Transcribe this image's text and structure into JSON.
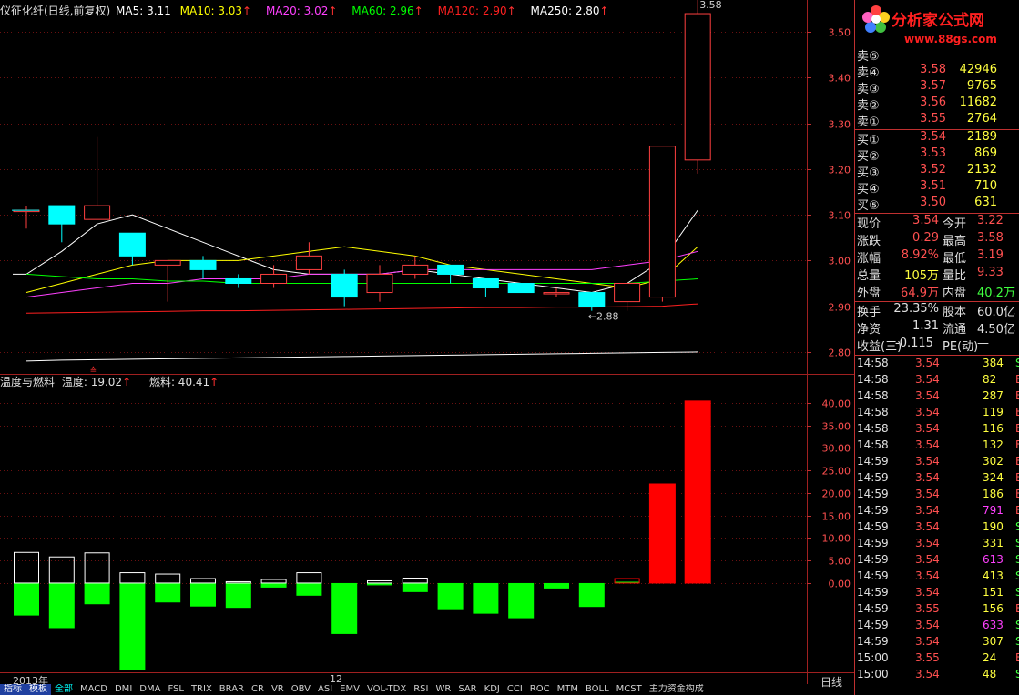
{
  "colors": {
    "up": "#ff4040",
    "down": "#00ffff",
    "ma5": "#ffffff",
    "ma10": "#ffff00",
    "ma20": "#ff40ff",
    "ma60": "#00ff00",
    "ma120": "#ff2020",
    "ma250": "#ffffff",
    "fuel": "#ff0000",
    "temp": "#00ff00"
  },
  "header": {
    "stock_title": "仪征化纤(日线,前复权)",
    "ma5": "MA5: 3.11",
    "ma10": "MA10: 3.03",
    "ma20": "MA20: 3.02",
    "ma60": "MA60: 2.96",
    "ma120": "MA120: 2.90",
    "ma250": "MA250: 2.80",
    "up_arrow": "↑"
  },
  "indicator": {
    "title": "温度与燃料",
    "temp_label": "温度: 19.02",
    "fuel_label": "燃料: 40.41",
    "up_arrow": "↑"
  },
  "price_axis": {
    "labels": [
      "3.50",
      "3.40",
      "3.30",
      "3.20",
      "3.10",
      "3.00",
      "2.90",
      "2.80"
    ]
  },
  "indicator_axis": {
    "labels": [
      "40.00",
      "35.00",
      "30.00",
      "25.00",
      "20.00",
      "15.00",
      "10.00",
      "5.00",
      "0.00"
    ]
  },
  "annotations": {
    "high": "3.58",
    "low": "2.88",
    "high_marker": "↙",
    "low_marker": "←",
    "year": "2013年",
    "month": "12",
    "event_marker": "≙"
  },
  "chart_data": {
    "type": "candlestick",
    "price_ylim": [
      2.75,
      3.55
    ],
    "candles": [
      {
        "o": 3.11,
        "c": 3.11,
        "h": 3.12,
        "l": 3.07
      },
      {
        "o": 3.12,
        "c": 3.08,
        "h": 3.12,
        "l": 3.04
      },
      {
        "o": 3.09,
        "c": 3.12,
        "h": 3.27,
        "l": 3.09
      },
      {
        "o": 3.06,
        "c": 3.01,
        "h": 3.06,
        "l": 2.99
      },
      {
        "o": 2.99,
        "c": 3.0,
        "h": 3.0,
        "l": 2.91
      },
      {
        "o": 3.0,
        "c": 2.98,
        "h": 3.01,
        "l": 2.96
      },
      {
        "o": 2.96,
        "c": 2.95,
        "h": 2.97,
        "l": 2.94
      },
      {
        "o": 2.95,
        "c": 2.97,
        "h": 2.99,
        "l": 2.94
      },
      {
        "o": 2.98,
        "c": 3.01,
        "h": 3.04,
        "l": 2.97
      },
      {
        "o": 2.97,
        "c": 2.92,
        "h": 2.98,
        "l": 2.9
      },
      {
        "o": 2.93,
        "c": 2.97,
        "h": 2.99,
        "l": 2.91
      },
      {
        "o": 2.97,
        "c": 2.99,
        "h": 3.01,
        "l": 2.96
      },
      {
        "o": 2.99,
        "c": 2.97,
        "h": 2.99,
        "l": 2.95
      },
      {
        "o": 2.96,
        "c": 2.94,
        "h": 2.96,
        "l": 2.92
      },
      {
        "o": 2.95,
        "c": 2.93,
        "h": 2.95,
        "l": 2.93
      },
      {
        "o": 2.93,
        "c": 2.93,
        "h": 2.94,
        "l": 2.92
      },
      {
        "o": 2.93,
        "c": 2.9,
        "h": 2.93,
        "l": 2.89
      },
      {
        "o": 2.91,
        "c": 2.95,
        "h": 2.95,
        "l": 2.89
      },
      {
        "o": 2.92,
        "c": 3.25,
        "h": 3.25,
        "l": 2.91
      },
      {
        "o": 3.22,
        "c": 3.54,
        "h": 3.58,
        "l": 3.19
      }
    ],
    "ma": [
      {
        "name": "MA5",
        "color": "#ffffff",
        "values": [
          2.97,
          3.02,
          3.08,
          3.1,
          3.07,
          3.04,
          3.01,
          2.98,
          2.97,
          2.97,
          2.97,
          2.98,
          2.97,
          2.96,
          2.95,
          2.94,
          2.93,
          2.95,
          3.0,
          3.11
        ]
      },
      {
        "name": "MA10",
        "color": "#ffff00",
        "values": [
          2.93,
          2.95,
          2.97,
          2.99,
          3.0,
          3.0,
          3.0,
          3.01,
          3.02,
          3.03,
          3.02,
          3.01,
          2.99,
          2.98,
          2.97,
          2.96,
          2.95,
          2.94,
          2.96,
          3.03
        ]
      },
      {
        "name": "MA20",
        "color": "#ff40ff",
        "values": [
          2.92,
          2.93,
          2.94,
          2.95,
          2.95,
          2.96,
          2.96,
          2.96,
          2.97,
          2.97,
          2.97,
          2.98,
          2.98,
          2.98,
          2.98,
          2.98,
          2.98,
          2.99,
          3.0,
          3.02
        ]
      },
      {
        "name": "MA60",
        "color": "#00ff00",
        "values": [
          2.97,
          2.965,
          2.96,
          2.96,
          2.955,
          2.955,
          2.95,
          2.95,
          2.95,
          2.95,
          2.95,
          2.95,
          2.95,
          2.95,
          2.95,
          2.95,
          2.95,
          2.95,
          2.955,
          2.96
        ]
      },
      {
        "name": "MA120",
        "color": "#ff2020",
        "values": [
          2.885,
          2.886,
          2.887,
          2.888,
          2.889,
          2.89,
          2.89,
          2.891,
          2.892,
          2.893,
          2.894,
          2.895,
          2.896,
          2.897,
          2.897,
          2.898,
          2.898,
          2.899,
          2.9,
          2.905
        ]
      },
      {
        "name": "MA250",
        "color": "#ffffff",
        "values": [
          2.78,
          2.782,
          2.783,
          2.784,
          2.785,
          2.786,
          2.787,
          2.788,
          2.789,
          2.79,
          2.791,
          2.792,
          2.793,
          2.794,
          2.795,
          2.796,
          2.797,
          2.798,
          2.799,
          2.8
        ]
      }
    ],
    "indicator_ylim": [
      -20,
      43
    ],
    "temp": [
      -7.2,
      -10,
      -4.7,
      -19.2,
      -4.3,
      -5.2,
      -5.5,
      -1,
      -2.8,
      -11.3,
      -0.5,
      -2,
      -6,
      -6.8,
      -7.8,
      -1.2,
      -5.3,
      0.3,
      0,
      0
    ],
    "fuel": [
      6.8,
      5.8,
      6.7,
      2.3,
      2,
      1,
      0.3,
      0.8,
      2.3,
      0,
      0.5,
      1.1,
      0,
      0,
      0,
      0,
      0,
      1,
      22,
      40.4
    ]
  },
  "order_book": {
    "asks": [
      {
        "label": "卖⑤",
        "price": "",
        "vol": ""
      },
      {
        "label": "卖④",
        "price": "3.58",
        "vol": "42946"
      },
      {
        "label": "卖③",
        "price": "3.57",
        "vol": "9765"
      },
      {
        "label": "卖②",
        "price": "3.56",
        "vol": "11682"
      },
      {
        "label": "卖①",
        "price": "3.55",
        "vol": "2764"
      }
    ],
    "bids": [
      {
        "label": "买①",
        "price": "3.54",
        "vol": "2189"
      },
      {
        "label": "买②",
        "price": "3.53",
        "vol": "869"
      },
      {
        "label": "买③",
        "price": "3.52",
        "vol": "2132"
      },
      {
        "label": "买④",
        "price": "3.51",
        "vol": "710"
      },
      {
        "label": "买⑤",
        "price": "3.50",
        "vol": "631"
      }
    ]
  },
  "quote": {
    "rows": [
      {
        "k1": "现价",
        "v1": "3.54",
        "k2": "今开",
        "v2": "3.22",
        "c1": "#ff5050",
        "c2": "#ff5050"
      },
      {
        "k1": "涨跌",
        "v1": "0.29",
        "k2": "最高",
        "v2": "3.58",
        "c1": "#ff5050",
        "c2": "#ff5050"
      },
      {
        "k1": "涨幅",
        "v1": "8.92%",
        "k2": "最低",
        "v2": "3.19",
        "c1": "#ff5050",
        "c2": "#ff5050"
      },
      {
        "k1": "总量",
        "v1": "105万",
        "k2": "量比",
        "v2": "9.33",
        "c1": "#ffff40",
        "c2": "#ff5050"
      },
      {
        "k1": "外盘",
        "v1": "64.9万",
        "k2": "内盘",
        "v2": "40.2万",
        "c1": "#ff5050",
        "c2": "#40ff40"
      },
      {
        "k1": "换手",
        "v1": "23.35%",
        "k2": "股本",
        "v2": "60.0亿",
        "c1": "#e0e0e0",
        "c2": "#e0e0e0"
      },
      {
        "k1": "净资",
        "v1": "1.31",
        "k2": "流通",
        "v2": "4.50亿",
        "c1": "#e0e0e0",
        "c2": "#e0e0e0"
      },
      {
        "k1": "收益(三)",
        "v1": "-0.115",
        "k2": "PE(动)",
        "v2": "—",
        "c1": "#e0e0e0",
        "c2": "#e0e0e0"
      }
    ]
  },
  "trades": [
    {
      "t": "14:58",
      "p": "3.54",
      "v": "384",
      "s": "S",
      "vc": "#ffff40",
      "sc": "#40ff40"
    },
    {
      "t": "14:58",
      "p": "3.54",
      "v": "82",
      "s": "B",
      "vc": "#ffff40",
      "sc": "#ff5050"
    },
    {
      "t": "14:58",
      "p": "3.54",
      "v": "287",
      "s": "B",
      "vc": "#ffff40",
      "sc": "#ff5050"
    },
    {
      "t": "14:58",
      "p": "3.54",
      "v": "119",
      "s": "B",
      "vc": "#ffff40",
      "sc": "#ff5050"
    },
    {
      "t": "14:58",
      "p": "3.54",
      "v": "116",
      "s": "B",
      "vc": "#ffff40",
      "sc": "#ff5050"
    },
    {
      "t": "14:58",
      "p": "3.54",
      "v": "132",
      "s": "B",
      "vc": "#ffff40",
      "sc": "#ff5050"
    },
    {
      "t": "14:59",
      "p": "3.54",
      "v": "302",
      "s": "B",
      "vc": "#ffff40",
      "sc": "#ff5050"
    },
    {
      "t": "14:59",
      "p": "3.54",
      "v": "324",
      "s": "B",
      "vc": "#ffff40",
      "sc": "#ff5050"
    },
    {
      "t": "14:59",
      "p": "3.54",
      "v": "186",
      "s": "B",
      "vc": "#ffff40",
      "sc": "#ff5050"
    },
    {
      "t": "14:59",
      "p": "3.54",
      "v": "791",
      "s": "B",
      "vc": "#ff40ff",
      "sc": "#ff5050"
    },
    {
      "t": "14:59",
      "p": "3.54",
      "v": "190",
      "s": "S",
      "vc": "#ffff40",
      "sc": "#40ff40"
    },
    {
      "t": "14:59",
      "p": "3.54",
      "v": "331",
      "s": "S",
      "vc": "#ffff40",
      "sc": "#40ff40"
    },
    {
      "t": "14:59",
      "p": "3.54",
      "v": "613",
      "s": "S",
      "vc": "#ff40ff",
      "sc": "#40ff40"
    },
    {
      "t": "14:59",
      "p": "3.54",
      "v": "413",
      "s": "S",
      "vc": "#ffff40",
      "sc": "#40ff40"
    },
    {
      "t": "14:59",
      "p": "3.54",
      "v": "151",
      "s": "S",
      "vc": "#ffff40",
      "sc": "#40ff40"
    },
    {
      "t": "14:59",
      "p": "3.55",
      "v": "156",
      "s": "B",
      "vc": "#ffff40",
      "sc": "#ff5050"
    },
    {
      "t": "14:59",
      "p": "3.54",
      "v": "633",
      "s": "S",
      "vc": "#ff40ff",
      "sc": "#40ff40"
    },
    {
      "t": "14:59",
      "p": "3.54",
      "v": "307",
      "s": "S",
      "vc": "#ffff40",
      "sc": "#40ff40"
    },
    {
      "t": "15:00",
      "p": "3.55",
      "v": "24",
      "s": "B",
      "vc": "#ffff40",
      "sc": "#ff5050"
    },
    {
      "t": "15:00",
      "p": "3.54",
      "v": "48",
      "s": "S",
      "vc": "#ffff40",
      "sc": "#40ff40"
    }
  ],
  "logo": {
    "name": "分析家公式网",
    "url": "www.88gs.com"
  },
  "tabs": {
    "items": [
      "指标",
      "模板",
      "全部",
      "MACD",
      "DMI",
      "DMA",
      "FSL",
      "TRIX",
      "BRAR",
      "CR",
      "VR",
      "OBV",
      "ASI",
      "EMV",
      "VOL-TDX",
      "RSI",
      "WR",
      "SAR",
      "KDJ",
      "CCI",
      "ROC",
      "MTM",
      "BOLL",
      "MCST",
      "主力资金构成"
    ],
    "period": "日线"
  }
}
